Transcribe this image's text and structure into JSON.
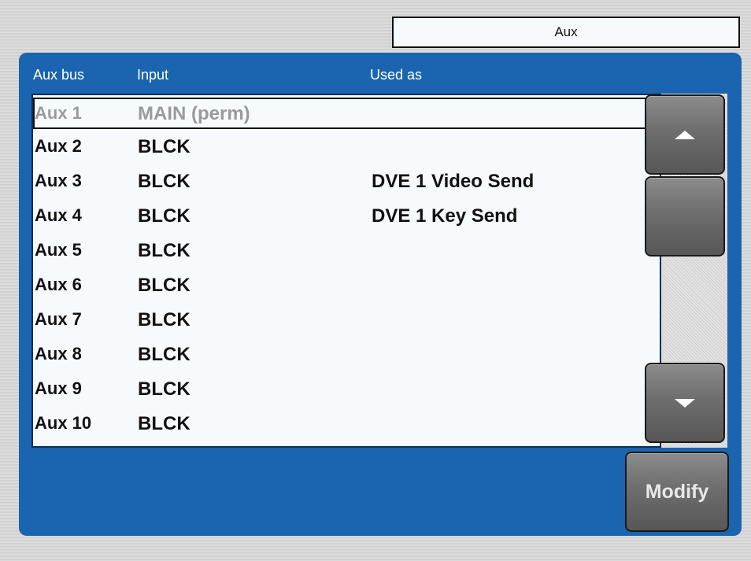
{
  "title": "Aux",
  "columns": {
    "bus": "Aux bus",
    "input": "Input",
    "used": "Used as"
  },
  "rows": [
    {
      "bus": "Aux 1",
      "input": "MAIN (perm)",
      "used": ""
    },
    {
      "bus": "Aux 2",
      "input": "BLCK",
      "used": ""
    },
    {
      "bus": "Aux 3",
      "input": "BLCK",
      "used": "DVE 1 Video Send"
    },
    {
      "bus": "Aux 4",
      "input": "BLCK",
      "used": "DVE 1 Key Send"
    },
    {
      "bus": "Aux 5",
      "input": "BLCK",
      "used": ""
    },
    {
      "bus": "Aux 6",
      "input": "BLCK",
      "used": ""
    },
    {
      "bus": "Aux 7",
      "input": "BLCK",
      "used": ""
    },
    {
      "bus": "Aux 8",
      "input": "BLCK",
      "used": ""
    },
    {
      "bus": "Aux 9",
      "input": "BLCK",
      "used": ""
    },
    {
      "bus": "Aux 10",
      "input": "BLCK",
      "used": ""
    }
  ],
  "buttons": {
    "modify": "Modify"
  },
  "icons": {
    "scroll_up": "chevron-up-icon",
    "scroll_down": "chevron-down-icon"
  },
  "colors": {
    "panel": "#1a64b0",
    "list_bg": "#f7fafc",
    "button": "#6e6e6e"
  }
}
